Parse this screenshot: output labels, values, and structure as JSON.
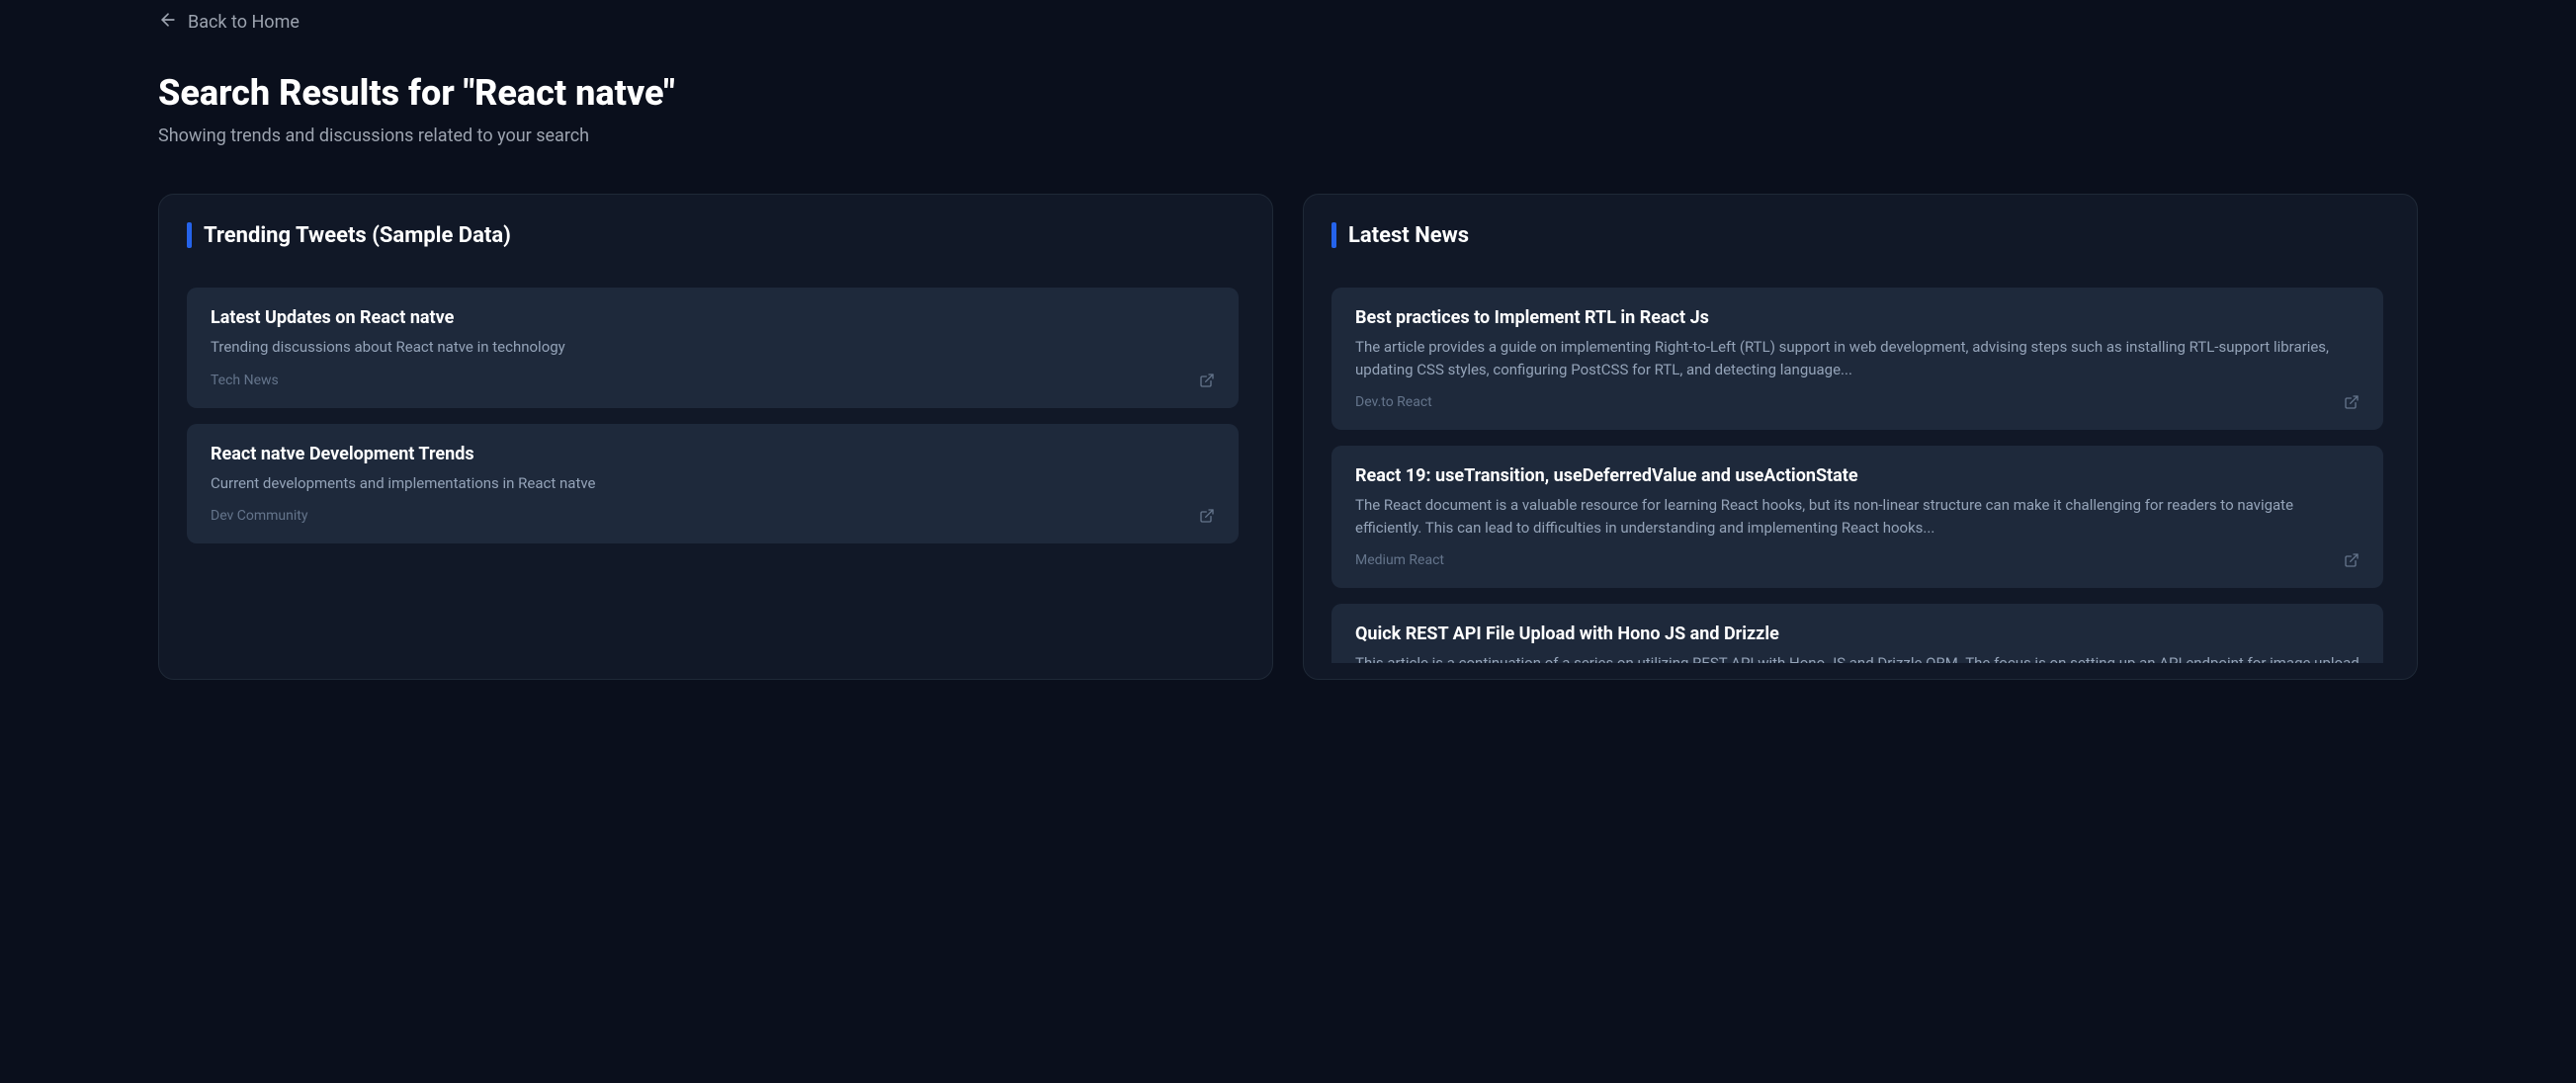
{
  "nav": {
    "back_label": "Back to Home"
  },
  "header": {
    "title": "Search Results for \"React natve\"",
    "subtitle": "Showing trends and discussions related to your search"
  },
  "panels": {
    "tweets": {
      "title": "Trending Tweets (Sample Data)",
      "items": [
        {
          "title": "Latest Updates on React natve",
          "desc": "Trending discussions about React natve in technology",
          "source": "Tech News"
        },
        {
          "title": "React natve Development Trends",
          "desc": "Current developments and implementations in React natve",
          "source": "Dev Community"
        }
      ]
    },
    "news": {
      "title": "Latest News",
      "items": [
        {
          "title": "Best practices to Implement RTL in React Js",
          "desc": "The article provides a guide on implementing Right-to-Left (RTL) support in web development, advising steps such as installing RTL-support libraries, updating CSS styles, configuring PostCSS for RTL, and detecting language...",
          "source": "Dev.to React"
        },
        {
          "title": "React 19: useTransition, useDeferredValue and useActionState",
          "desc": "The React document is a valuable resource for learning React hooks, but its non-linear structure can make it challenging for readers to navigate efficiently. This can lead to difficulties in understanding and implementing React hooks...",
          "source": "Medium React"
        },
        {
          "title": "Quick REST API File Upload with Hono JS and Drizzle",
          "desc": "This article is a continuation of a series on utilizing REST API with Hono JS and Drizzle ORM. The focus is on setting up an API endpoint for image upload and",
          "source": ""
        }
      ]
    }
  }
}
